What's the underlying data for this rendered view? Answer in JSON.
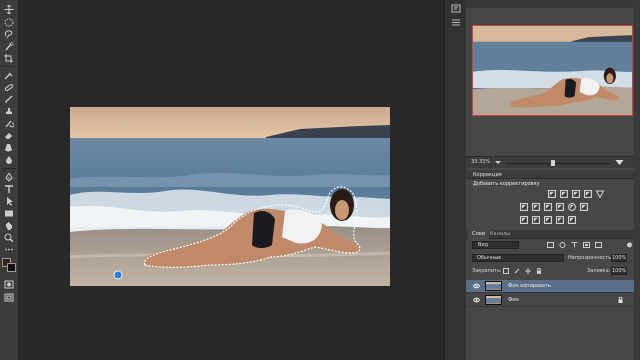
{
  "toolbar": {
    "tools": [
      {
        "icon": "move-tool-icon"
      },
      {
        "icon": "marquee-tool-icon"
      },
      {
        "icon": "lasso-tool-icon"
      },
      {
        "icon": "quick-selection-tool-icon"
      },
      {
        "icon": "crop-tool-icon"
      },
      {
        "icon": "eyedropper-tool-icon"
      },
      {
        "icon": "healing-brush-tool-icon"
      },
      {
        "icon": "brush-tool-icon"
      },
      {
        "icon": "clone-stamp-tool-icon"
      },
      {
        "icon": "history-brush-tool-icon"
      },
      {
        "icon": "eraser-tool-icon"
      },
      {
        "icon": "gradient-tool-icon"
      },
      {
        "icon": "blur-tool-icon"
      },
      {
        "icon": "dodge-tool-icon"
      },
      {
        "icon": "pen-tool-icon"
      },
      {
        "icon": "type-tool-icon"
      },
      {
        "icon": "path-selection-tool-icon"
      },
      {
        "icon": "rectangle-tool-icon"
      },
      {
        "icon": "hand-tool-icon"
      },
      {
        "icon": "zoom-tool-icon"
      }
    ],
    "foreground_color": "#3a2418",
    "background_color": "#111111"
  },
  "navigator": {
    "zoom": "33.33%"
  },
  "adjustments": {
    "title": "Коррекция",
    "subtitle": "Добавить корректировку"
  },
  "layers": {
    "tabs": [
      "Слои",
      "Каналы"
    ],
    "filter_kind": "Вид",
    "blend_mode": "Обычные",
    "opacity_label": "Непрозрачность:",
    "opacity_value": "100%",
    "lock_label": "Закрепить:",
    "fill_label": "Заливка:",
    "fill_value": "100%",
    "items": [
      {
        "name": "Фон копировать",
        "selected": true,
        "locked": false
      },
      {
        "name": "Фон",
        "selected": false,
        "locked": true
      }
    ]
  },
  "colors": {
    "ui_dark": "#282828",
    "panel": "#474747",
    "selection_highlight": "#5a6e8a",
    "navigator_frame": "#d04040"
  }
}
